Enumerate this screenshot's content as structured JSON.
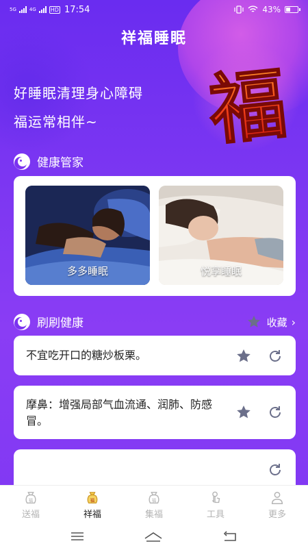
{
  "status_bar": {
    "network_1": "5G",
    "network_2": "4G",
    "hd": "HD",
    "time": "17:54",
    "battery": "43%",
    "battery_level": 0.43
  },
  "app": {
    "title": "祥福睡眠"
  },
  "hero": {
    "line1": "好睡眠清理身心障碍",
    "line2": "福运常相伴~",
    "fu_char": "福"
  },
  "health_section": {
    "title": "健康管家",
    "cards": [
      {
        "label": "多多睡眠"
      },
      {
        "label": "悦享睡眠"
      }
    ]
  },
  "brush_section": {
    "title": "刷刷健康",
    "favorites_label": "收藏",
    "tips": [
      {
        "text": "不宜吃开口的糖炒板栗。"
      },
      {
        "text": "摩鼻：增强局部气血流通、润肺、防感冒。"
      },
      {
        "text": ""
      }
    ]
  },
  "tabbar": {
    "tabs": [
      {
        "label": "送福",
        "icon": "fu-bag-icon"
      },
      {
        "label": "祥福",
        "icon": "fu-bag-icon"
      },
      {
        "label": "集福",
        "icon": "fu-bag-icon"
      },
      {
        "label": "工具",
        "icon": "tool-hand-icon"
      },
      {
        "label": "更多",
        "icon": "person-icon"
      }
    ],
    "active_index": 1
  },
  "colors": {
    "primary": "#7b33f0",
    "accent_red": "#e8261a",
    "star": "#6b6f8a"
  }
}
